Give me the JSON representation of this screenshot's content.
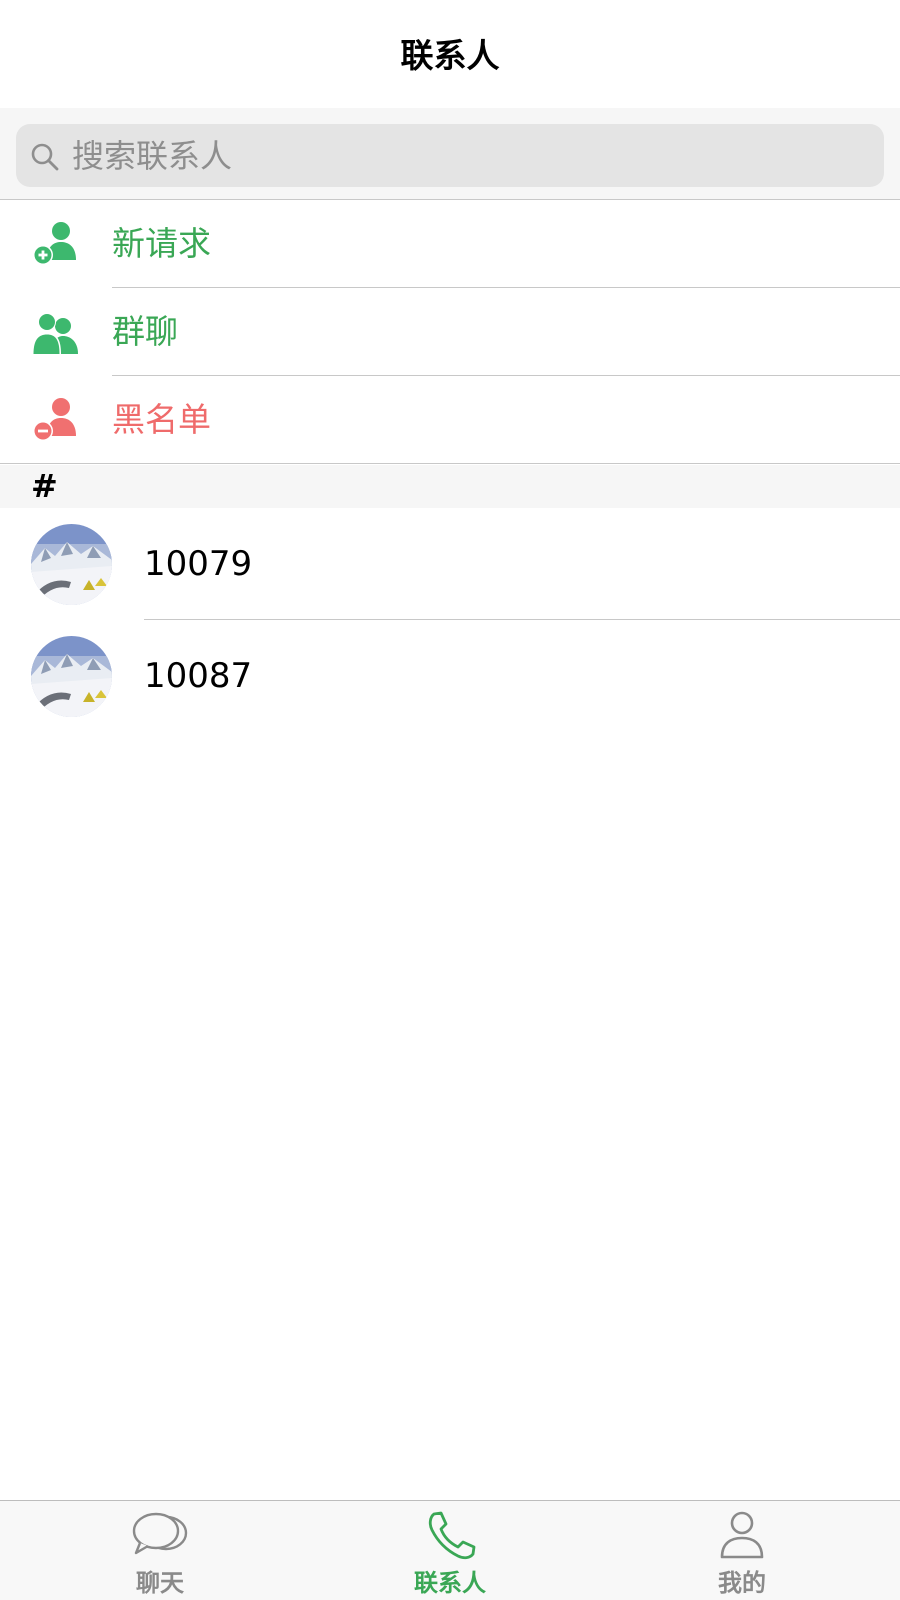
{
  "navbar": {
    "title": "联系人"
  },
  "search": {
    "placeholder": "搜索联系人",
    "value": ""
  },
  "functions": [
    {
      "label": "新请求",
      "icon": "add-person-icon",
      "color": "#3aa755"
    },
    {
      "label": "群聊",
      "icon": "group-icon",
      "color": "#3aa755"
    },
    {
      "label": "黑名单",
      "icon": "remove-person-icon",
      "color": "#ef6b6b"
    }
  ],
  "section": {
    "letter": "#"
  },
  "contacts": [
    {
      "name": "10079",
      "avatar": "avatar-snow-mountain"
    },
    {
      "name": "10087",
      "avatar": "avatar-snow-mountain"
    }
  ],
  "tabbar": {
    "active_index": 1,
    "active_color": "#3aa755",
    "inactive_color": "#8a8a8a",
    "tabs": [
      {
        "label": "聊天",
        "icon": "chat-bubbles-icon"
      },
      {
        "label": "联系人",
        "icon": "phone-icon"
      },
      {
        "label": "我的",
        "icon": "person-icon"
      }
    ]
  }
}
